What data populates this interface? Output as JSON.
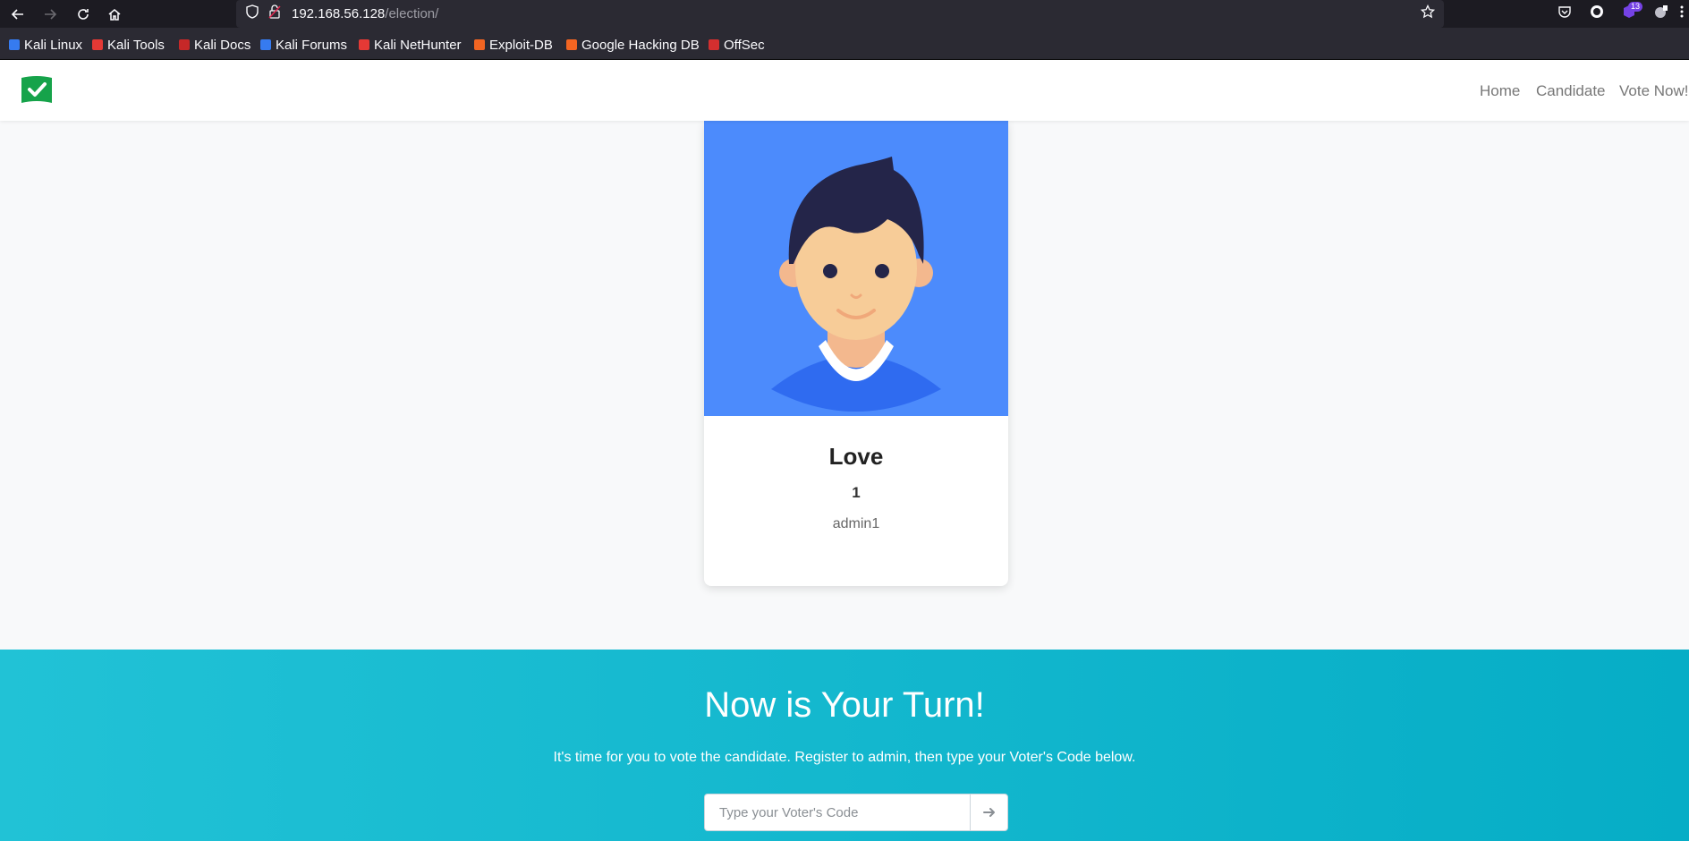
{
  "browser": {
    "url_host": "192.168.56.128",
    "url_path": "/election/",
    "container_badge": "13",
    "bookmarks": [
      {
        "label": "Kali Linux",
        "color": "#367bf0"
      },
      {
        "label": "Kali Tools",
        "color": "#e53935"
      },
      {
        "label": "Kali Docs",
        "color": "#c62828"
      },
      {
        "label": "Kali Forums",
        "color": "#367bf0"
      },
      {
        "label": "Kali NetHunter",
        "color": "#e53935"
      },
      {
        "label": "Exploit-DB",
        "color": "#f26522"
      },
      {
        "label": "Google Hacking DB",
        "color": "#f26522"
      },
      {
        "label": "OffSec",
        "color": "#d32f2f"
      }
    ]
  },
  "site": {
    "logo_icon": "check-flag-icon",
    "nav": [
      "Home",
      "Candidate",
      "Vote Now!"
    ]
  },
  "candidate": {
    "name": "Love",
    "number": "1",
    "username": "admin1"
  },
  "vote": {
    "title": "Now is Your Turn!",
    "description": "It's time for you to vote the candidate. Register to admin, then type your Voter's Code below.",
    "placeholder": "Type your Voter's Code",
    "submit_icon": "arrow-right-icon"
  },
  "colors": {
    "accent_green": "#16a34a",
    "card_photo_bg": "#4c8bfc",
    "vote_gradient_start": "#21c2d6",
    "vote_gradient_end": "#06adc6"
  }
}
